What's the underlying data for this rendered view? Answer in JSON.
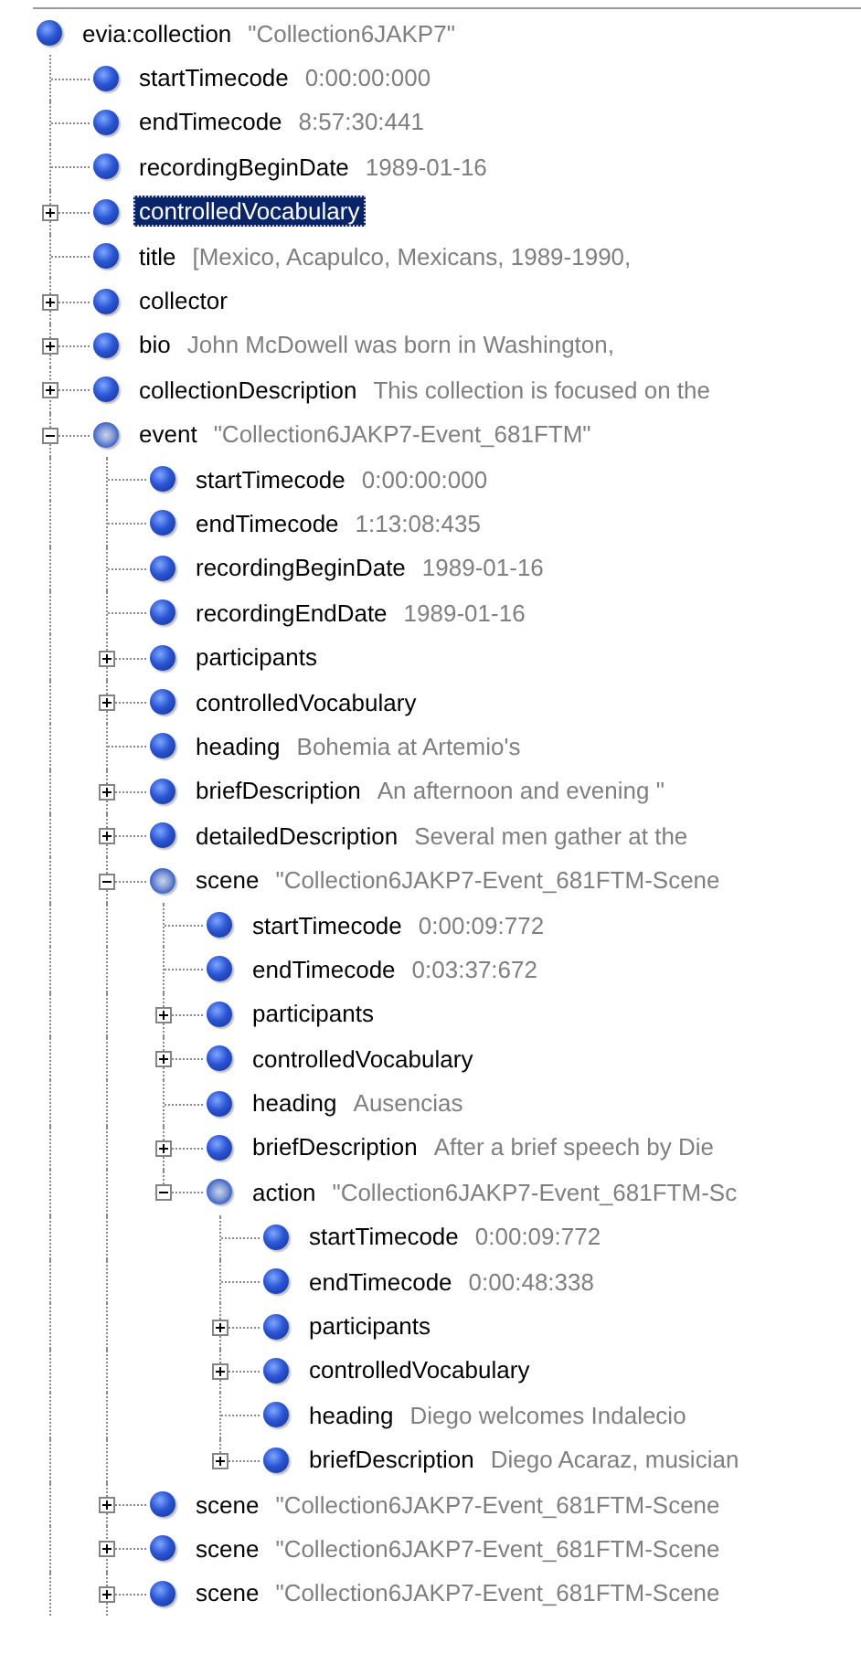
{
  "tree": {
    "root": {
      "name": "evia:collection",
      "value": "\"Collection6JAKP7\"",
      "selected": false,
      "children": [
        {
          "name": "startTimecode",
          "value": "0:00:00:000",
          "selected": false
        },
        {
          "name": "endTimecode",
          "value": "8:57:30:441",
          "selected": false
        },
        {
          "name": "recordingBeginDate",
          "value": "1989-01-16",
          "selected": false
        },
        {
          "name": "controlledVocabulary",
          "selected": true,
          "expanded": false
        },
        {
          "name": "title",
          "value": "[Mexico, Acapulco, Mexicans, 1989-1990,",
          "selected": false
        },
        {
          "name": "collector",
          "selected": false,
          "expanded": false
        },
        {
          "name": "bio",
          "value": "John McDowell was born in Washington,",
          "selected": false,
          "expanded": false
        },
        {
          "name": "collectionDescription",
          "value": "This collection is focused on the",
          "selected": false,
          "expanded": false
        },
        {
          "name": "event",
          "value": "\"Collection6JAKP7-Event_681FTM\"",
          "selected": false,
          "expanded": true,
          "children": [
            {
              "name": "startTimecode",
              "value": "0:00:00:000",
              "selected": false
            },
            {
              "name": "endTimecode",
              "value": "1:13:08:435",
              "selected": false
            },
            {
              "name": "recordingBeginDate",
              "value": "1989-01-16",
              "selected": false
            },
            {
              "name": "recordingEndDate",
              "value": "1989-01-16",
              "selected": false
            },
            {
              "name": "participants",
              "selected": false,
              "expanded": false
            },
            {
              "name": "controlledVocabulary",
              "selected": false,
              "expanded": false
            },
            {
              "name": "heading",
              "value": "Bohemia at Artemio's",
              "selected": false
            },
            {
              "name": "briefDescription",
              "value": "An afternoon and evening \"",
              "selected": false,
              "expanded": false
            },
            {
              "name": "detailedDescription",
              "value": "Several men gather at the",
              "selected": false,
              "expanded": false
            },
            {
              "name": "scene",
              "value": "\"Collection6JAKP7-Event_681FTM-Scene",
              "selected": false,
              "expanded": true,
              "children": [
                {
                  "name": "startTimecode",
                  "value": "0:00:09:772",
                  "selected": false
                },
                {
                  "name": "endTimecode",
                  "value": "0:03:37:672",
                  "selected": false
                },
                {
                  "name": "participants",
                  "selected": false,
                  "expanded": false
                },
                {
                  "name": "controlledVocabulary",
                  "selected": false,
                  "expanded": false
                },
                {
                  "name": "heading",
                  "value": "Ausencias",
                  "selected": false
                },
                {
                  "name": "briefDescription",
                  "value": "After a brief speech by Die",
                  "selected": false,
                  "expanded": false
                },
                {
                  "name": "action",
                  "value": "\"Collection6JAKP7-Event_681FTM-Sc",
                  "selected": false,
                  "expanded": true,
                  "children": [
                    {
                      "name": "startTimecode",
                      "value": "0:00:09:772",
                      "selected": false
                    },
                    {
                      "name": "endTimecode",
                      "value": "0:00:48:338",
                      "selected": false
                    },
                    {
                      "name": "participants",
                      "selected": false,
                      "expanded": false
                    },
                    {
                      "name": "controlledVocabulary",
                      "selected": false,
                      "expanded": false
                    },
                    {
                      "name": "heading",
                      "value": "Diego welcomes Indalecio",
                      "selected": false
                    },
                    {
                      "name": "briefDescription",
                      "value": "Diego Acaraz, musician",
                      "selected": false,
                      "expanded": false
                    }
                  ]
                }
              ]
            },
            {
              "name": "scene",
              "value": "\"Collection6JAKP7-Event_681FTM-Scene",
              "selected": false,
              "expanded": false
            },
            {
              "name": "scene",
              "value": "\"Collection6JAKP7-Event_681FTM-Scene",
              "selected": false,
              "expanded": false
            },
            {
              "name": "scene",
              "value": "\"Collection6JAKP7-Event_681FTM-Scene",
              "selected": false,
              "expanded": false
            }
          ]
        }
      ]
    }
  }
}
